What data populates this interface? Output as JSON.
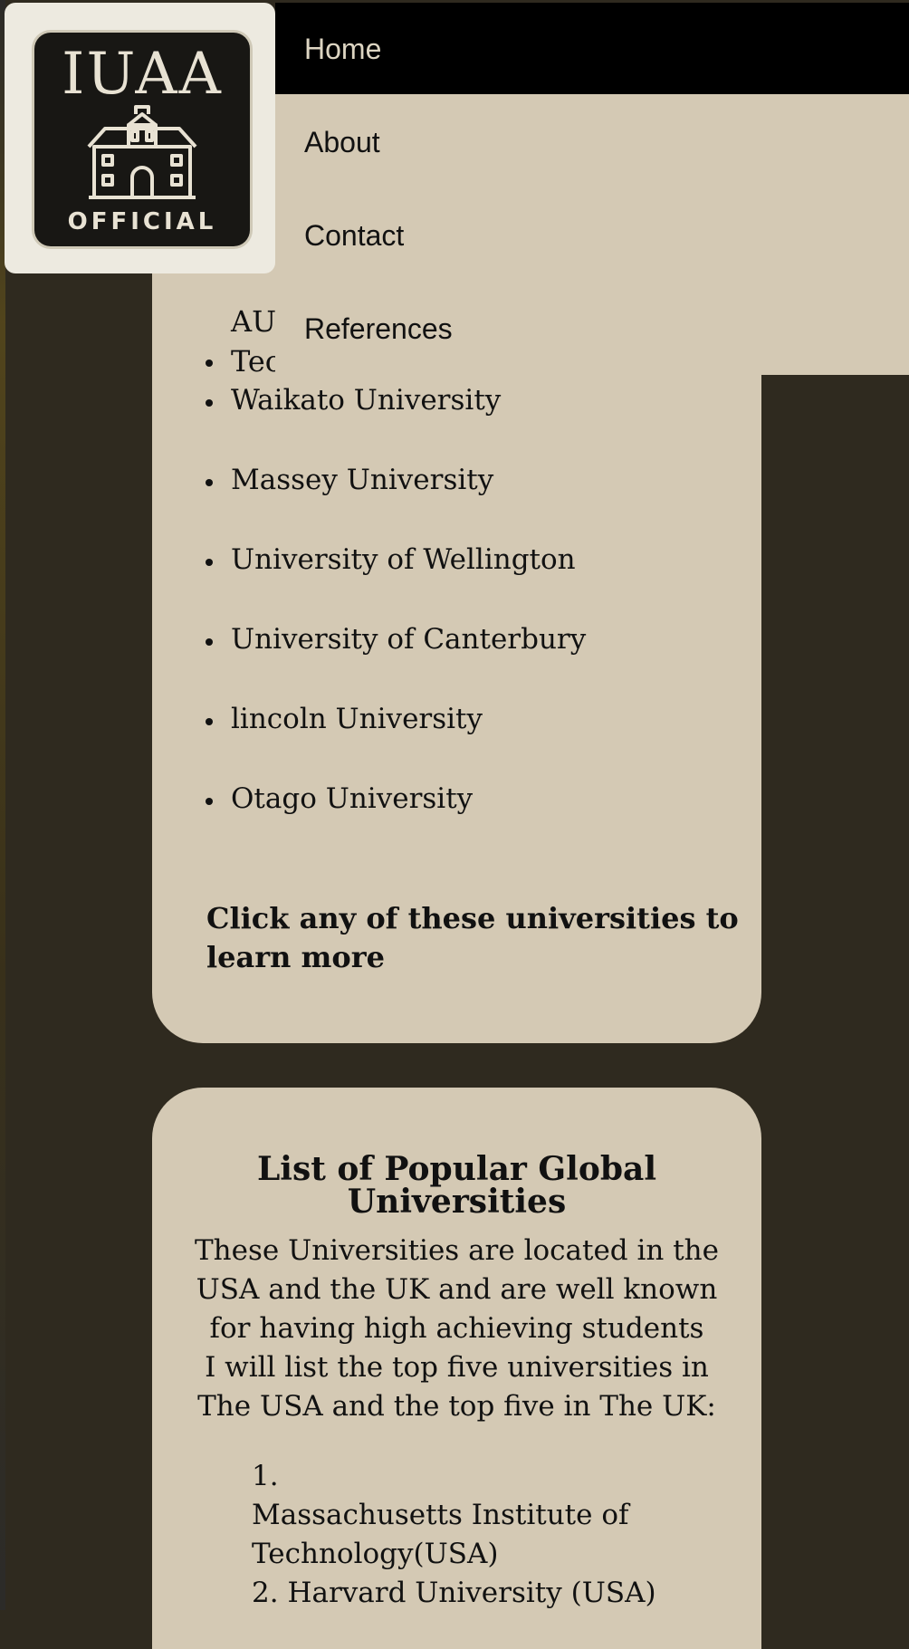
{
  "logo": {
    "title": "IUAA",
    "subtitle": "OFFICIAL"
  },
  "nav": {
    "home": "Home",
    "about": "About",
    "contact": "Contact",
    "references": "References"
  },
  "nz_section": {
    "partial_item_top": "AU",
    "partial_item_bottom": "Tec",
    "items": [
      "Waikato University",
      "Massey University",
      "University of Wellington",
      "University of Canterbury",
      "lincoln University",
      "Otago University"
    ],
    "cta": "Click any of these universities to learn more"
  },
  "global_section": {
    "title": "List of Popular Global Universities",
    "description_line_1": "These Universities are located in the USA and the UK and are well known for having high achieving students",
    "description_line_2": "I will list the top five universities in The USA and the top five in The UK:",
    "items": [
      {
        "number": "1.",
        "label": "Massachusetts Institute of Technology(USA)"
      },
      {
        "number": "2.",
        "label": "Harvard University (USA)"
      }
    ]
  }
}
